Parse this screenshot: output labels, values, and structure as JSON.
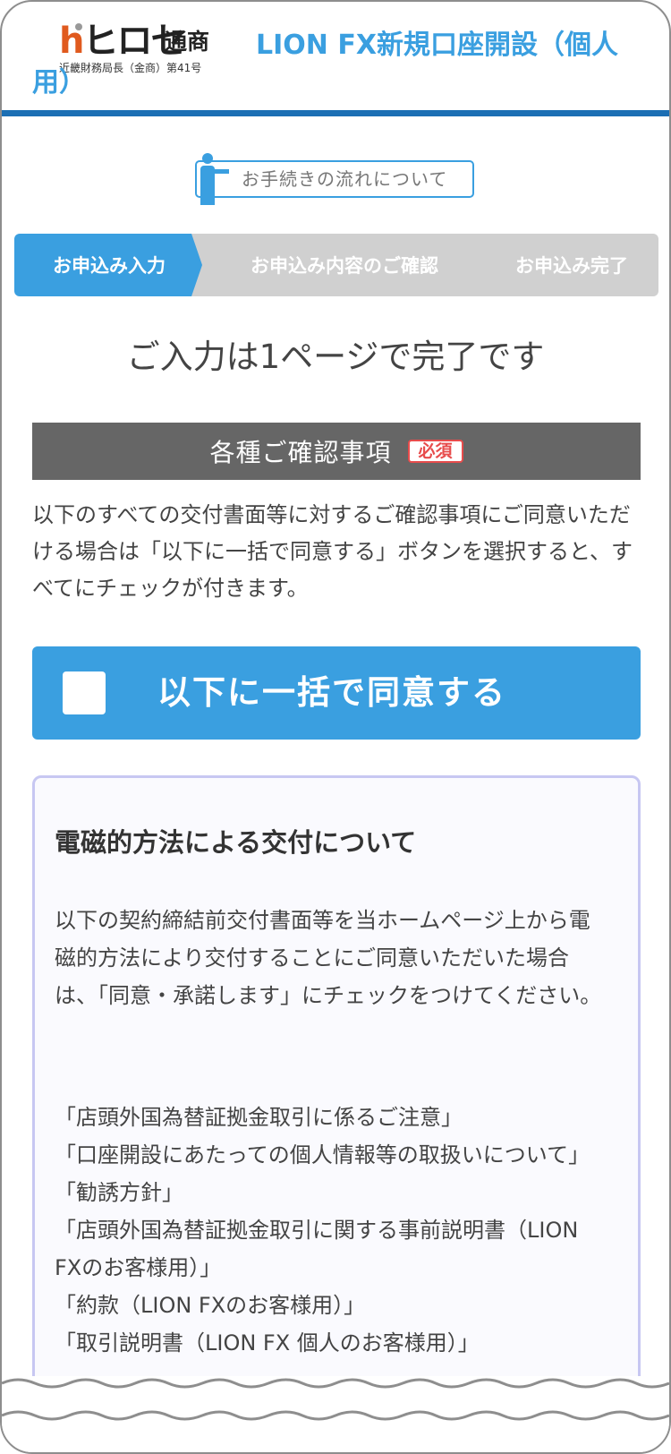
{
  "header": {
    "logo_mark": "ヒロセ",
    "logo_name": "通商",
    "logo_reg": "近畿財務局長（金商）第41号",
    "title": "LION FX新規口座開設（個人用）"
  },
  "flow_button": {
    "label": "お手続きの流れについて"
  },
  "steps": [
    {
      "label": "お申込み入力",
      "active": true
    },
    {
      "label": "お申込み内容のご確認",
      "active": false
    },
    {
      "label": "お申込み完了",
      "active": false
    }
  ],
  "headline": "ご入力は1ページで完了です",
  "section": {
    "title": "各種ご確認事項",
    "badge": "必須",
    "intro": "以下のすべての交付書面等に対するご確認事項にご同意いただける場合は「以下に一括で同意する」ボタンを選択すると、すべてにチェックが付きます。"
  },
  "agree_all": {
    "label": "以下に一括で同意する",
    "checked": false
  },
  "electronic": {
    "title": "電磁的方法による交付について",
    "body": "以下の契約締結前交付書面等を当ホームページ上から電磁的方法により交付することにご同意いただいた場合は、「同意・承諾します」にチェックをつけてください。",
    "documents": [
      "「店頭外国為替証拠金取引に係るご注意」",
      "「口座開設にあたっての個人情報等の取扱いについて」",
      "「勧誘方針」",
      "「店頭外国為替証拠金取引に関する事前説明書（LION FXのお客様用）」",
      "「約款（LION FXのお客様用）」",
      "「取引説明書（LION FX 個人のお客様用）」"
    ]
  },
  "colors": {
    "brand_blue": "#3a9fe0",
    "header_rule": "#1c6fb4",
    "step_inactive": "#d0d0d0",
    "section_bar": "#666666",
    "required_red": "#e74c4c",
    "box_border": "#c7c7f2"
  }
}
